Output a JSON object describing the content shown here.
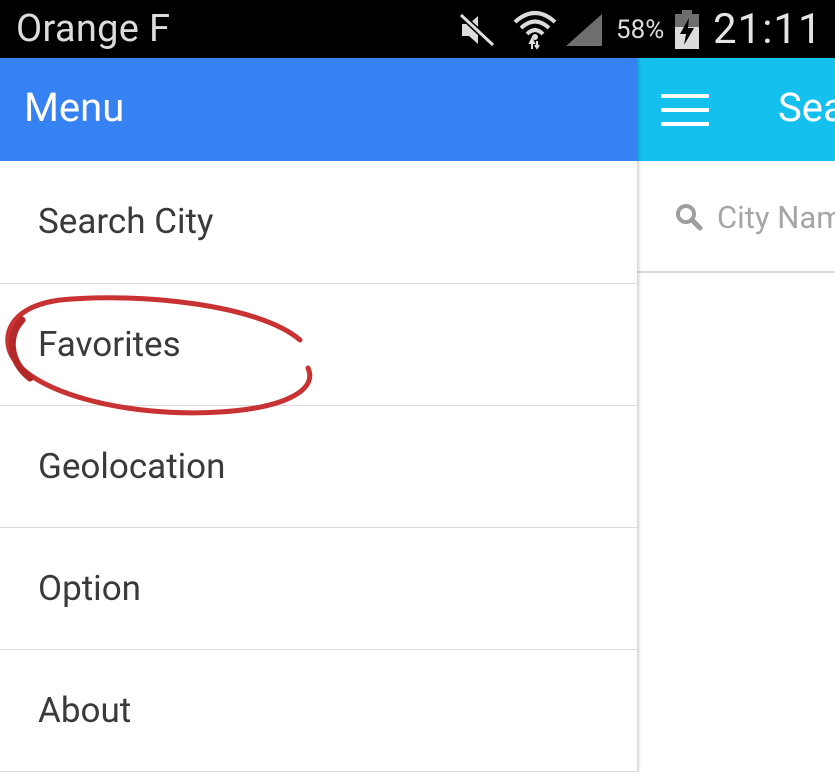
{
  "status_bar": {
    "carrier": "Orange F",
    "battery_percent": "58%",
    "time": "21:11",
    "icons": [
      "mute-icon",
      "wifi-icon",
      "signal-icon",
      "battery-charging-icon"
    ]
  },
  "drawer": {
    "title": "Menu",
    "items": [
      {
        "label": "Search City"
      },
      {
        "label": "Favorites",
        "annotated": true
      },
      {
        "label": "Geolocation"
      },
      {
        "label": "Option"
      },
      {
        "label": "About"
      }
    ]
  },
  "main": {
    "title": "Sea",
    "menu_icon": "hamburger-icon",
    "search": {
      "placeholder": "City Nam",
      "icon": "search-icon"
    }
  },
  "colors": {
    "drawer_header": "#3782f3",
    "main_toolbar": "#14c0ee",
    "annotation": "#c83232",
    "status_bar": "#000000"
  }
}
